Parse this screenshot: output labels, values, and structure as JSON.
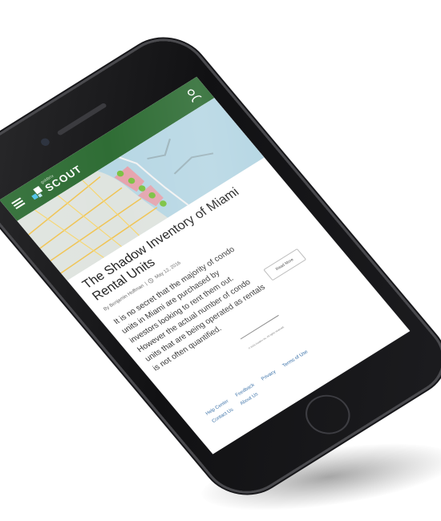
{
  "app": {
    "logo": {
      "small_text": "goldtrix",
      "big_text": "SCOUT"
    },
    "icons": {
      "menu": "menu-icon",
      "user": "user-icon",
      "clock": "clock-icon"
    },
    "colors": {
      "header_green": "#2f6d35",
      "link_blue": "#2c67a2",
      "marker_green": "#7cc243",
      "water_blue": "#b9d8e4"
    }
  },
  "article": {
    "title": "The Shadow Inventory of Miami Rental Units",
    "author": "By Benjamin Hoffman",
    "separator": "|",
    "date": "May 12, 2016",
    "body": "It is no secret that the majority of condo units in Miami are purchased by investors looking to rent them out. However the actual number of condo units that are being operated as rentals is not often quantified.",
    "read_more": "Read More"
  },
  "footer": {
    "small_text": "© 2016 Goldtrix Inc. All rights reserved.",
    "links_row1": [
      "Help Center",
      "Feedback",
      "Privacy",
      "Terms of Use"
    ],
    "links_row2": [
      "Contact Us",
      "About Us"
    ]
  }
}
